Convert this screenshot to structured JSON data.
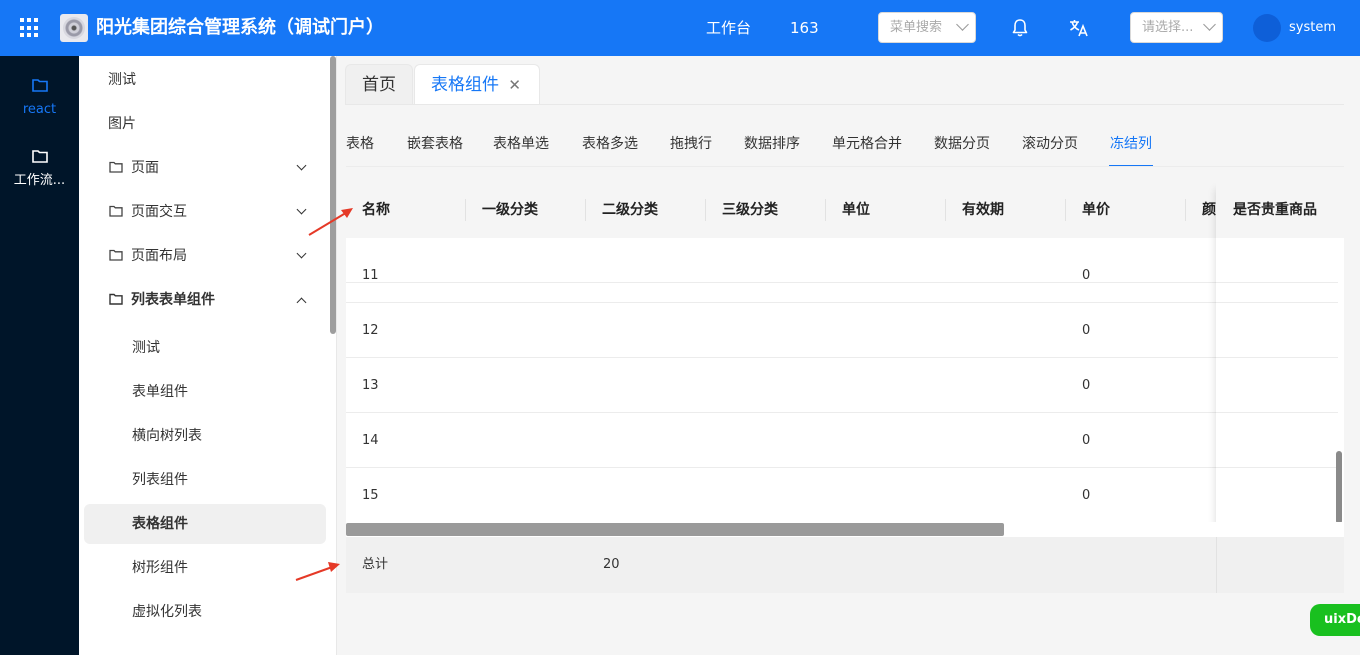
{
  "header": {
    "app_title": "阳光集团综合管理系统（调试门户）",
    "workbench": "工作台",
    "message_count": "163",
    "menu_search_placeholder": "菜单搜索",
    "select_placeholder": "请选择...",
    "username": "system"
  },
  "rail": {
    "items": [
      {
        "label": "react",
        "icon": "folder-icon",
        "active": true
      },
      {
        "label": "工作流...",
        "icon": "folder-icon",
        "active": false
      }
    ]
  },
  "sidebar": {
    "items": [
      {
        "label": "测试"
      },
      {
        "label": "图片"
      },
      {
        "label": "页面",
        "icon": "folder-icon",
        "expand": "down"
      },
      {
        "label": "页面交互",
        "icon": "folder-icon",
        "expand": "down"
      },
      {
        "label": "页面布局",
        "icon": "folder-icon",
        "expand": "down"
      },
      {
        "label": "列表表单组件",
        "icon": "folder-icon",
        "expand": "up"
      }
    ],
    "subitems": [
      {
        "label": "测试"
      },
      {
        "label": "表单组件"
      },
      {
        "label": "横向树列表"
      },
      {
        "label": "列表组件"
      },
      {
        "label": "表格组件",
        "active": true
      },
      {
        "label": "树形组件"
      },
      {
        "label": "虚拟化列表"
      }
    ]
  },
  "page_tabs": {
    "home": "首页",
    "current": "表格组件",
    "close_symbol": "✕"
  },
  "sub_tabs": [
    "表格",
    "嵌套表格",
    "表格单选",
    "表格多选",
    "拖拽行",
    "数据排序",
    "单元格合并",
    "数据分页",
    "滚动分页",
    "冻结列"
  ],
  "sub_tab_active": "冻结列",
  "table": {
    "columns": [
      "名称",
      "一级分类",
      "二级分类",
      "三级分类",
      "单位",
      "有效期",
      "单价",
      "颜"
    ],
    "frozen_column": "是否贵重商品",
    "rows": [
      {
        "name": "11",
        "price": "0"
      },
      {
        "name": "12",
        "price": "0"
      },
      {
        "name": "13",
        "price": "0"
      },
      {
        "name": "14",
        "price": "0"
      },
      {
        "name": "15",
        "price": "0"
      }
    ],
    "summary_label": "总计",
    "summary_value": "20"
  },
  "floating_button": "uixDev",
  "colors": {
    "primary": "#1677f6",
    "rail_bg": "#001529",
    "annotation_arrow": "#e53927",
    "floating_button": "#19c01f"
  }
}
